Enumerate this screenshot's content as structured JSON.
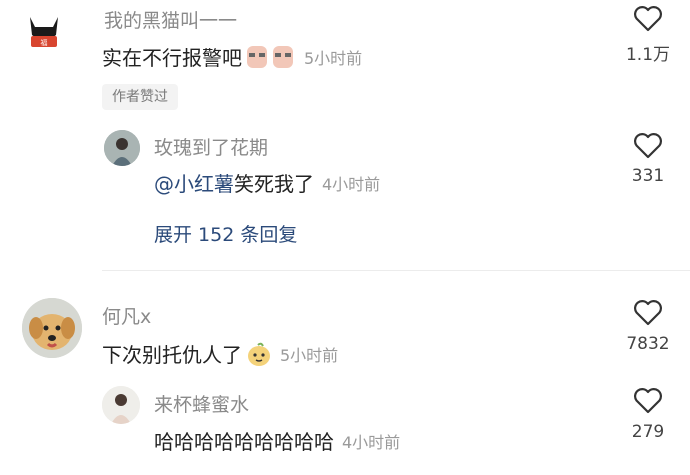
{
  "comments": [
    {
      "username": "我的黑猫叫一一",
      "text": "实在不行报警吧",
      "time": "5小时前",
      "likes": "1.1万",
      "badge": "作者赞过"
    },
    {
      "username": "玫瑰到了花期",
      "mention": "@小红薯",
      "text": " 笑死我了",
      "time": "4小时前",
      "likes": "331",
      "expand": "展开 152 条回复"
    },
    {
      "username": "何凡x",
      "text": "下次别托仇人了",
      "time": "5小时前",
      "likes": "7832"
    },
    {
      "username": "来杯蜂蜜水",
      "text": "哈哈哈哈哈哈哈哈哈",
      "time": "4小时前",
      "likes": "279"
    }
  ]
}
